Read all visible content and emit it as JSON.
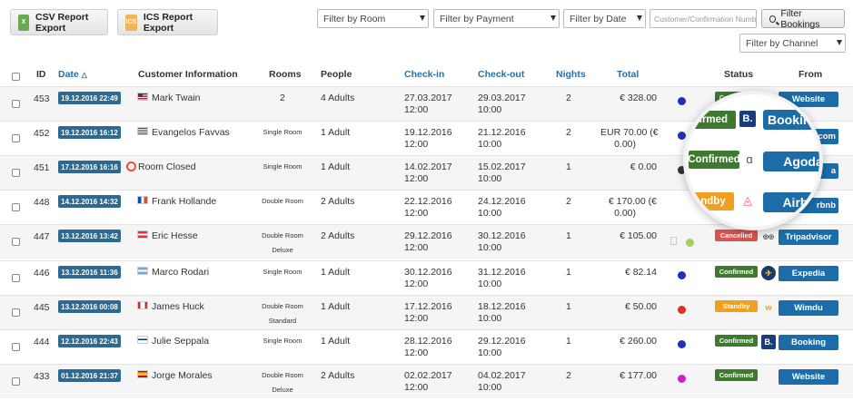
{
  "toolbar": {
    "csv_label": "CSV Report Export",
    "csv_icon": "csv-file-icon",
    "ics_label": "ICS Report Export",
    "ics_icon": "ics-file-icon",
    "filter_room": "Filter by Room",
    "filter_payment": "Filter by Payment",
    "filter_date": "Filter by Date",
    "search_placeholder": "Customer/Confirmation Numb",
    "filter_bookings": "Filter Bookings",
    "filter_channel": "Filter by Channel"
  },
  "columns": {
    "id": "ID",
    "date": "Date",
    "customer": "Customer Information",
    "rooms": "Rooms",
    "people": "People",
    "checkin": "Check-in",
    "checkout": "Check-out",
    "nights": "Nights",
    "total": "Total",
    "status": "Status",
    "from": "From"
  },
  "rows": [
    {
      "id": "453",
      "date": "19.12.2016 22:49",
      "flag": "us-flag-icon",
      "name": "Mark Twain",
      "rooms": "2",
      "rooms2": "",
      "people": "4 Adults",
      "cin": "27.03.2017",
      "cint": "12:00",
      "cout": "29.03.2017",
      "coutt": "10:00",
      "nights": "2",
      "total": "€ 328.00",
      "total2": "",
      "dot": "#1f2fbf",
      "status": "Confirmed",
      "status_color": "#3d7a2e",
      "source": "Website",
      "source_icon": ""
    },
    {
      "id": "452",
      "date": "19.12.2016 16:12",
      "flag": "greece-flag-icon",
      "name": "Evangelos Favvas",
      "rooms": "Single Room",
      "rooms2": "",
      "people": "1 Adult",
      "cin": "19.12.2016",
      "cint": "12:00",
      "cout": "21.12.2016",
      "coutt": "10:00",
      "nights": "2",
      "total": "EUR 70.00  (€",
      "total2": "0.00)",
      "dot": "#1f2fbf",
      "status": "",
      "status_color": "#3d7a2e",
      "source": "",
      "source_icon": ""
    },
    {
      "id": "451",
      "date": "17.12.2016 16:16",
      "flag": "",
      "name": "Room Closed",
      "rooms": "Single Room",
      "rooms2": "",
      "people": "1 Adult",
      "cin": "14.02.2017",
      "cint": "12:00",
      "cout": "15.02.2017",
      "coutt": "10:00",
      "nights": "1",
      "total": "€ 0.00",
      "total2": "",
      "dot": "#333333",
      "status": "",
      "status_color": "",
      "source": "",
      "source_icon": ""
    },
    {
      "id": "448",
      "date": "14.12.2016 14:32",
      "flag": "france-flag-icon",
      "name": "Frank Hollande",
      "rooms": "Double Room",
      "rooms2": "",
      "people": "2 Adults",
      "cin": "22.12.2016",
      "cint": "12:00",
      "cout": "24.12.2016",
      "coutt": "10:00",
      "nights": "2",
      "total": "€ 170.00  (€",
      "total2": "0.00)",
      "dot": "",
      "status": "",
      "status_color": "",
      "source": "",
      "source_icon": ""
    },
    {
      "id": "447",
      "date": "13.12.2016 13:42",
      "flag": "austria-flag-icon",
      "name": "Eric Hesse",
      "rooms": "Double Room",
      "rooms2": "Deluxe",
      "people": "2 Adults",
      "cin": "29.12.2016",
      "cint": "12:00",
      "cout": "30.12.2016",
      "coutt": "10:00",
      "nights": "1",
      "total": "€ 105.00",
      "total2": "",
      "dot": "",
      "status": "Cancelled",
      "status_color": "#d9534f",
      "source": "Tripadvisor",
      "source_icon": "tripadvisor-icon"
    },
    {
      "id": "446",
      "date": "13.12.2016 11:36",
      "flag": "argentina-flag-icon",
      "name": "Marco Rodari",
      "rooms": "Single Room",
      "rooms2": "",
      "people": "1 Adult",
      "cin": "30.12.2016",
      "cint": "12:00",
      "cout": "31.12.2016",
      "coutt": "10:00",
      "nights": "1",
      "total": "€ 82.14",
      "total2": "",
      "dot": "#1f2fbf",
      "status": "Confirmed",
      "status_color": "#3d7a2e",
      "source": "Expedia",
      "source_icon": "expedia-icon"
    },
    {
      "id": "445",
      "date": "13.12.2016 00:08",
      "flag": "canada-flag-icon",
      "name": "James Huck",
      "rooms": "Double Room",
      "rooms2": "Standard",
      "people": "1 Adult",
      "cin": "17.12.2016",
      "cint": "12:00",
      "cout": "18.12.2016",
      "coutt": "10:00",
      "nights": "1",
      "total": "€ 50.00",
      "total2": "",
      "dot": "#d9341f",
      "status": "Standby",
      "status_color": "#f0a01e",
      "source": "Wimdu",
      "source_icon": "wimdu-icon"
    },
    {
      "id": "444",
      "date": "12.12.2016 22:43",
      "flag": "finland-flag-icon",
      "name": "Julie Seppala",
      "rooms": "Single Room",
      "rooms2": "",
      "people": "1 Adult",
      "cin": "28.12.2016",
      "cint": "12:00",
      "cout": "29.12.2016",
      "coutt": "10:00",
      "nights": "1",
      "total": "€ 260.00",
      "total2": "",
      "dot": "#1f2fbf",
      "status": "Confirmed",
      "status_color": "#3d7a2e",
      "source": "Booking",
      "source_icon": "booking-icon"
    },
    {
      "id": "433",
      "date": "01.12.2016 21:37",
      "flag": "spain-flag-icon",
      "name": "Jorge Morales",
      "rooms": "Double Room",
      "rooms2": "Deluxe",
      "people": "2 Adults",
      "cin": "02.02.2017",
      "cint": "12:00",
      "cout": "04.02.2017",
      "coutt": "10:00",
      "nights": "2",
      "total": "€ 177.00",
      "total2": "",
      "dot": "#d41fc8",
      "status": "Confirmed",
      "status_color": "#3d7a2e",
      "source": "Website",
      "source_icon": ""
    }
  ],
  "magnifier": {
    "rows": [
      {
        "status": "nfirmed",
        "status_color": "#3d7a2e",
        "icon": "booking-icon",
        "source": "Booking"
      },
      {
        "status": "Confirmed",
        "status_color": "#3d7a2e",
        "icon": "agoda-icon",
        "source": "Agoda"
      },
      {
        "status": "ndby",
        "status_color": "#f0a01e",
        "icon": "airbnb-icon",
        "source": "Airbnb"
      }
    ]
  },
  "partial": {
    "row452_source": ".com",
    "row451_source": "a",
    "row448_source": "rbnb"
  }
}
